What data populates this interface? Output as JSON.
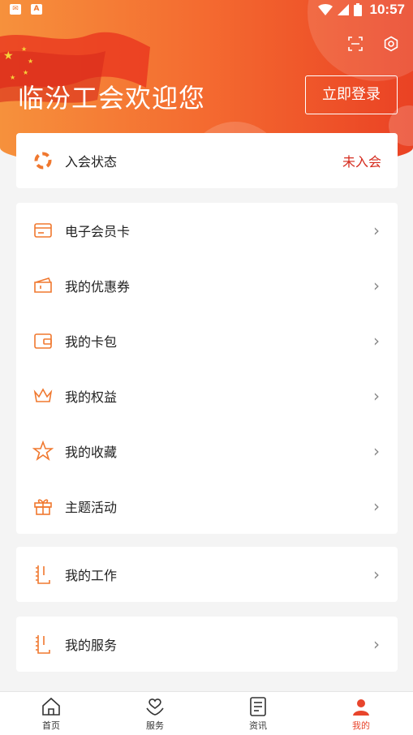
{
  "status_bar": {
    "time": "10:57"
  },
  "header": {
    "welcome_title": "临汾工会欢迎您",
    "login_button": "立即登录"
  },
  "membership": {
    "label": "入会状态",
    "value": "未入会"
  },
  "menu_items": [
    {
      "label": "电子会员卡",
      "icon": "member-card-icon"
    },
    {
      "label": "我的优惠券",
      "icon": "coupon-icon"
    },
    {
      "label": "我的卡包",
      "icon": "wallet-icon"
    },
    {
      "label": "我的权益",
      "icon": "crown-icon"
    },
    {
      "label": "我的收藏",
      "icon": "star-icon"
    },
    {
      "label": "主题活动",
      "icon": "gift-icon"
    }
  ],
  "work": {
    "label": "我的工作",
    "icon": "notebook-icon"
  },
  "service": {
    "label": "我的服务",
    "icon": "notebook-icon"
  },
  "bottom_nav": [
    {
      "label": "首页",
      "icon": "home-icon"
    },
    {
      "label": "服务",
      "icon": "heart-service-icon"
    },
    {
      "label": "资讯",
      "icon": "news-icon"
    },
    {
      "label": "我的",
      "icon": "profile-icon"
    }
  ],
  "colors": {
    "accent": "#f0782f",
    "header_start": "#f6913c",
    "header_end": "#ea4224",
    "status_red": "#d52b1e"
  }
}
